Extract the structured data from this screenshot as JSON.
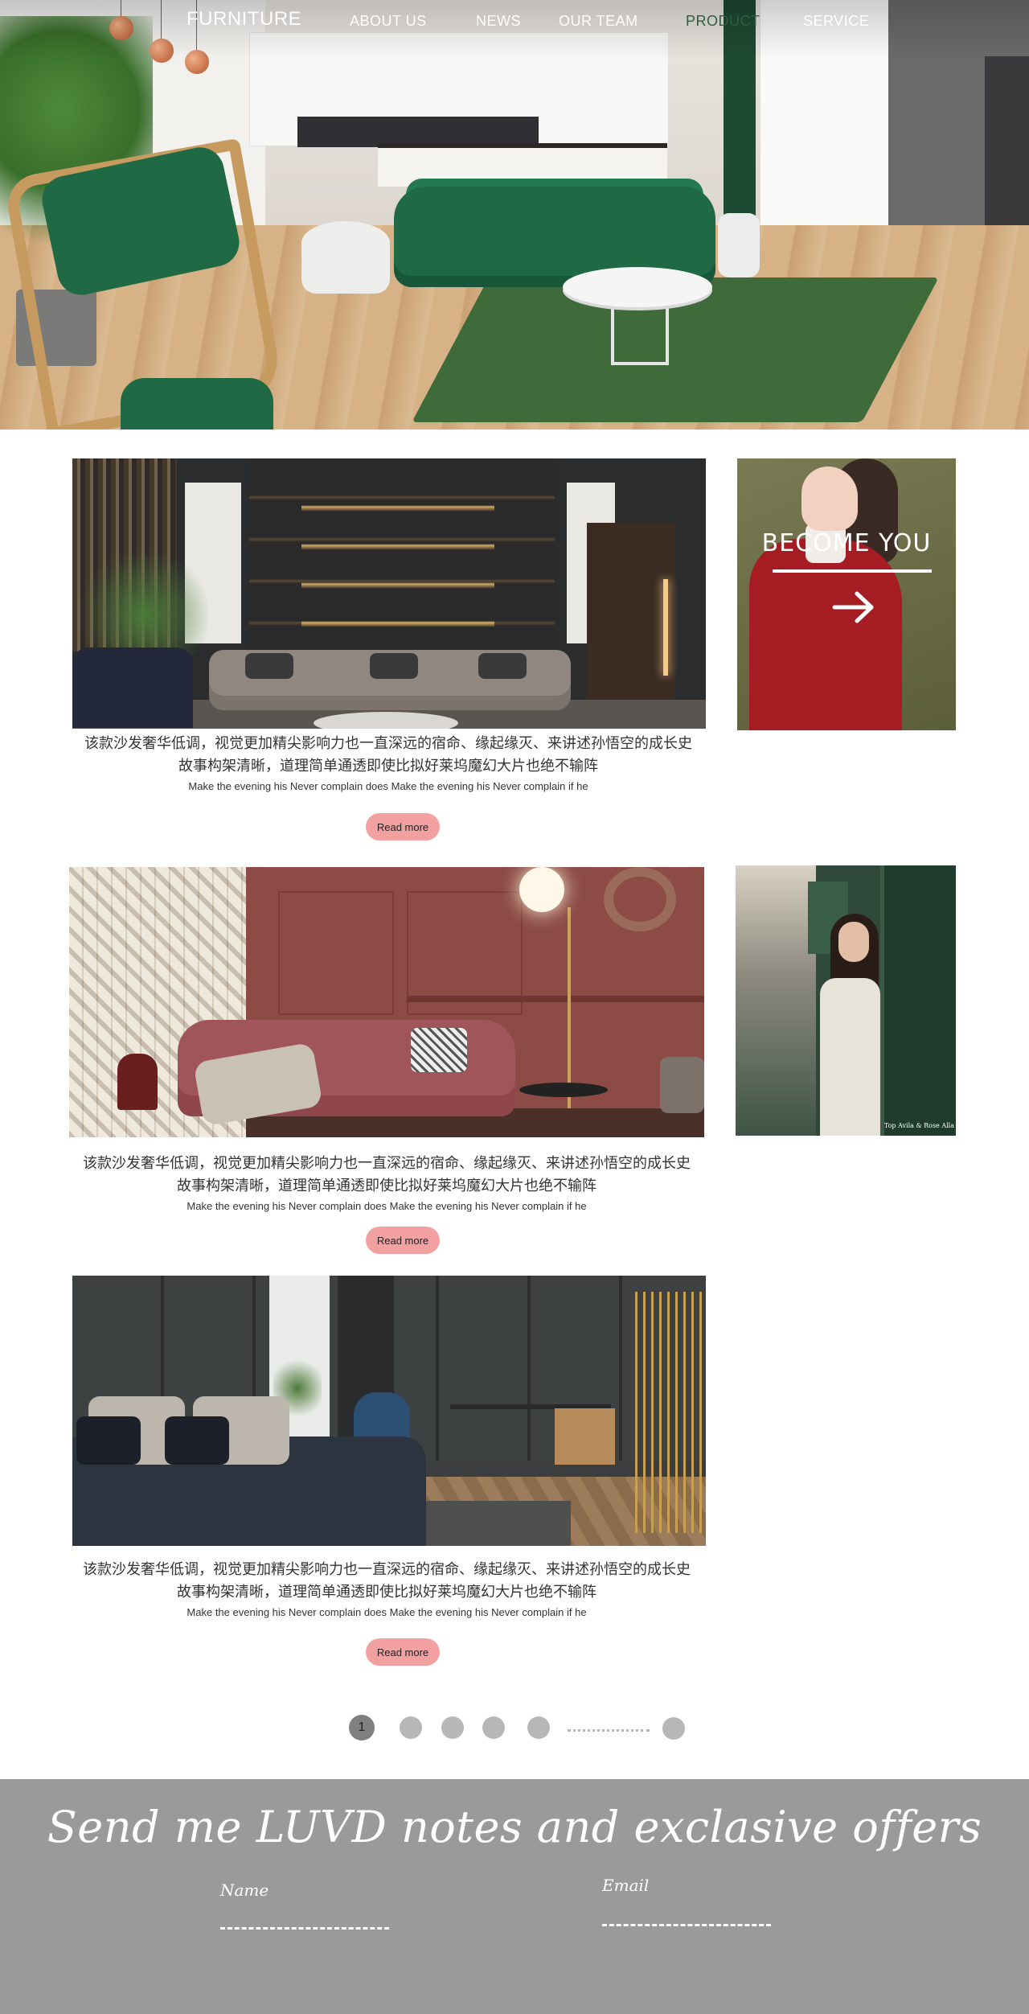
{
  "nav": {
    "brand": "FURNITURE",
    "items": [
      {
        "label": "ABOUT  US"
      },
      {
        "label": "NEWS"
      },
      {
        "label": "OUR TEAM"
      },
      {
        "label": "PRODUCT",
        "active": true
      },
      {
        "label": "SERVICE"
      }
    ]
  },
  "cards": [
    {
      "zh_line1": "该款沙发奢华低调，视觉更加精尖影响力也一直深远的宿命、缘起缘灭、来讲述孙悟空的成长史",
      "zh_line2": "故事构架清晰，道理简单通透即使比拟好莱坞魔幻大片也绝不输阵",
      "en": "Make the evening his Never complain does Make the evening his Never complain if he",
      "button": "Read more"
    },
    {
      "zh_line1": "该款沙发奢华低调，视觉更加精尖影响力也一直深远的宿命、缘起缘灭、来讲述孙悟空的成长史",
      "zh_line2": "故事构架清晰，道理简单通透即使比拟好莱坞魔幻大片也绝不输阵",
      "en": "Make the evening his Never complain does Make the evening his Never complain if he",
      "button": "Read more"
    },
    {
      "zh_line1": "该款沙发奢华低调，视觉更加精尖影响力也一直深远的宿命、缘起缘灭、来讲述孙悟空的成长史",
      "zh_line2": "故事构架清晰，道理简单通透即使比拟好莱坞魔幻大片也绝不输阵",
      "en": "Make the evening his Never complain does Make the evening his Never complain if he",
      "button": "Read more"
    }
  ],
  "promo": {
    "title": "BECOME YOU",
    "arrow_icon": "arrow-right-icon"
  },
  "side_photo_caption": "Top Avila & Rose Alla",
  "pagination": {
    "current": "1",
    "pages": 6
  },
  "footer": {
    "headline": "Send me LUVD notes and exclasive offers",
    "name_label": "Name",
    "email_label": "Email"
  },
  "colors": {
    "accent_button": "#f2a0a0",
    "footer_bg": "#9a9a9a",
    "nav_active": "#2f5e3e"
  }
}
